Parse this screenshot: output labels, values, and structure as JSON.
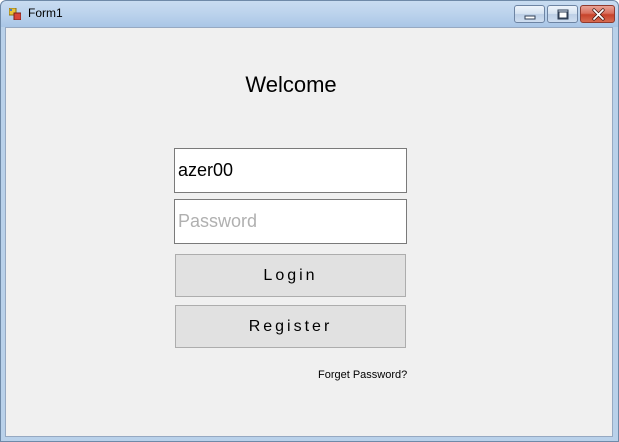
{
  "window": {
    "title": "Form1",
    "icon": "winforms-app-icon",
    "controls": {
      "minimize": "minimize-icon",
      "maximize": "restore-icon",
      "close": "close-icon"
    }
  },
  "form": {
    "heading": "Welcome",
    "username": {
      "value": "azer00",
      "placeholder": ""
    },
    "password": {
      "value": "",
      "placeholder": "Password"
    },
    "login_label": "Login",
    "register_label": "Register",
    "forgot_label": "Forget Password?"
  },
  "colors": {
    "form_background": "#f0f0f0",
    "button_background": "#e1e1e1",
    "placeholder": "#b0b0b0"
  }
}
